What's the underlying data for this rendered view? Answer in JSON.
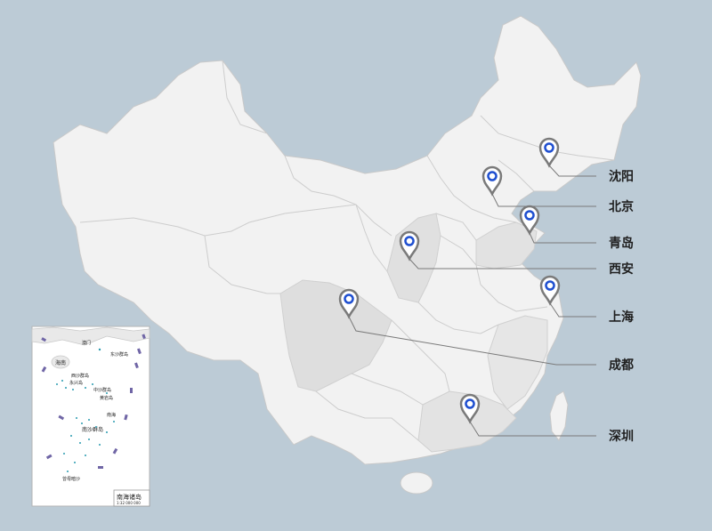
{
  "map": {
    "background_color": "#bccbd6",
    "land_color": "#f2f2f2",
    "highlight_color": "#e0e0e0",
    "pin_color": "#7a7a7a",
    "pin_dot_color": "#1f4fd0",
    "markers": [
      {
        "id": "shenyang",
        "label": "沈阳"
      },
      {
        "id": "beijing",
        "label": "北京"
      },
      {
        "id": "qingdao",
        "label": "青岛"
      },
      {
        "id": "xian",
        "label": "西安"
      },
      {
        "id": "shanghai",
        "label": "上海"
      },
      {
        "id": "chengdu",
        "label": "成都"
      },
      {
        "id": "shenzhen",
        "label": "深圳"
      }
    ],
    "inset": {
      "title": "南海诸岛",
      "scale": "1:32 000 000",
      "labels": [
        "海南",
        "东沙群岛",
        "西沙群岛",
        "永兴岛",
        "中沙群岛",
        "黄岩岛",
        "南沙群岛",
        "曾母暗沙",
        "南海",
        "澳门"
      ]
    }
  }
}
